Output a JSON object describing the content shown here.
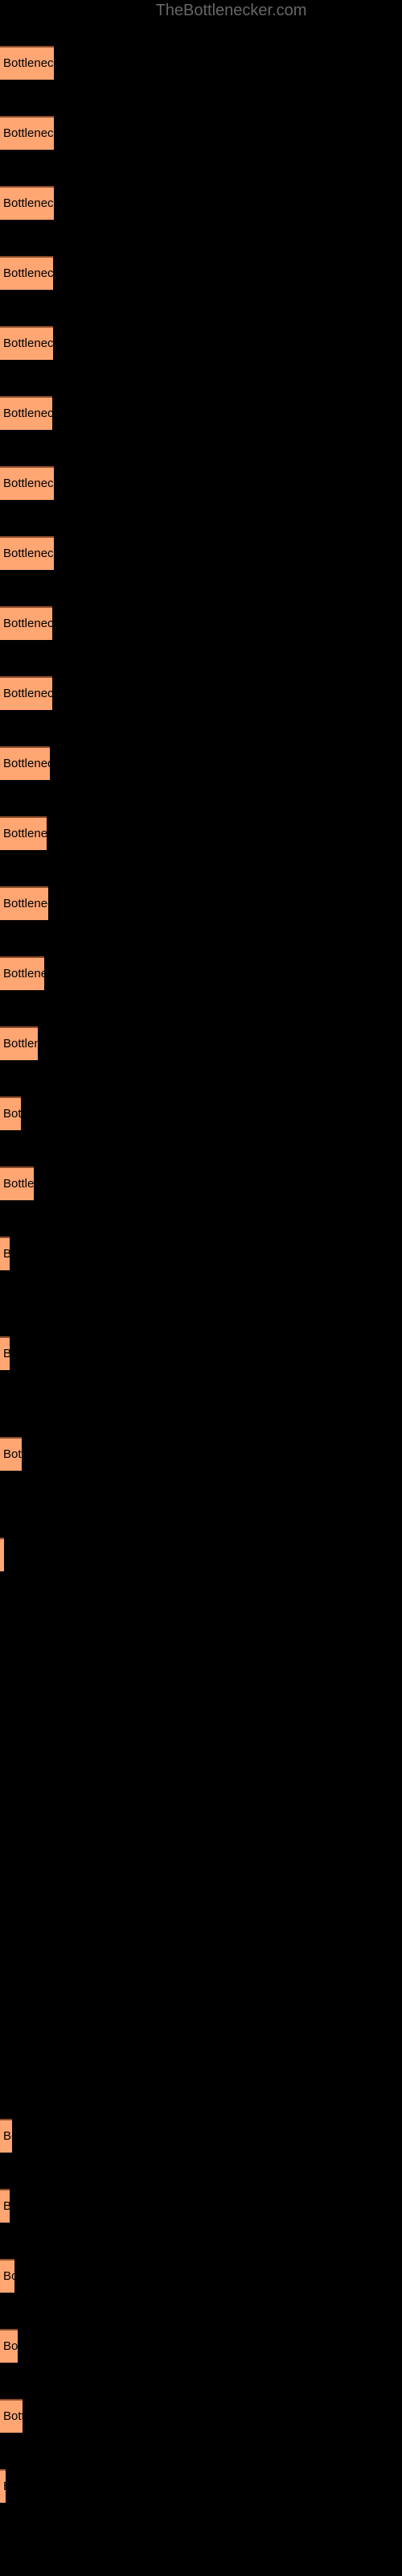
{
  "watermark": {
    "text": "TheBottlenecker.com"
  },
  "colors": {
    "background": "#000000",
    "bar_fill": "#ffa673",
    "bar_border_top": "#8a4a28",
    "label_text": "#000000",
    "watermark_text": "#666666"
  },
  "chart_data": {
    "type": "bar",
    "orientation": "horizontal",
    "title": "",
    "subtitle": "",
    "xlabel": "",
    "ylabel": "",
    "grid": false,
    "legend": false,
    "axis_visible": false,
    "xlim": [
      0,
      500
    ],
    "bar_label_prefix": "Bottleneck result",
    "note": "Each bar is labelled with the text 'Bottleneck result' which is clipped to the bar width, so shorter bars show fewer characters.",
    "categories": [
      "bar-1",
      "bar-2",
      "bar-3",
      "bar-4",
      "bar-5",
      "bar-6",
      "bar-7",
      "bar-8",
      "bar-9",
      "bar-10",
      "bar-11",
      "bar-12",
      "bar-13",
      "bar-14",
      "bar-15",
      "bar-16",
      "bar-17",
      "bar-18",
      "bar-19",
      "bar-20",
      "bar-21",
      "bar-22",
      "bar-23",
      "bar-24",
      "bar-25",
      "bar-26",
      "bar-27",
      "bar-28",
      "bar-29",
      "bar-30",
      "bar-31",
      "bar-32",
      "bar-33",
      "bar-34",
      "bar-35"
    ],
    "values": [
      67,
      67,
      67,
      66,
      66,
      65,
      67,
      67,
      65,
      65,
      62,
      58,
      60,
      55,
      47,
      26,
      42,
      12,
      12,
      27,
      5,
      0,
      0,
      0,
      0,
      0,
      0,
      0,
      15,
      12,
      18,
      22,
      28,
      7,
      0
    ],
    "bars": [
      {
        "label": "Bottleneck result",
        "width": 67,
        "y": 57
      },
      {
        "label": "Bottleneck result",
        "width": 67,
        "y": 144
      },
      {
        "label": "Bottleneck result",
        "width": 67,
        "y": 231
      },
      {
        "label": "Bottleneck result",
        "width": 66,
        "y": 318
      },
      {
        "label": "Bottleneck result",
        "width": 66,
        "y": 405
      },
      {
        "label": "Bottleneck result",
        "width": 65,
        "y": 492
      },
      {
        "label": "Bottleneck result",
        "width": 67,
        "y": 579
      },
      {
        "label": "Bottleneck result",
        "width": 67,
        "y": 666
      },
      {
        "label": "Bottleneck result",
        "width": 65,
        "y": 753
      },
      {
        "label": "Bottleneck result",
        "width": 65,
        "y": 840
      },
      {
        "label": "Bottleneck result",
        "width": 62,
        "y": 927
      },
      {
        "label": "Bottleneck result",
        "width": 58,
        "y": 1014
      },
      {
        "label": "Bottleneck result",
        "width": 60,
        "y": 1101
      },
      {
        "label": "Bottleneck result",
        "width": 55,
        "y": 1188
      },
      {
        "label": "Bottleneck result",
        "width": 47,
        "y": 1275
      },
      {
        "label": "Bottleneck result",
        "width": 26,
        "y": 1362
      },
      {
        "label": "Bottleneck result",
        "width": 42,
        "y": 1449
      },
      {
        "label": "Bottleneck result",
        "width": 12,
        "y": 1536
      },
      {
        "label": "Bottleneck result",
        "width": 12,
        "y": 1660
      },
      {
        "label": "Bottleneck result",
        "width": 27,
        "y": 1785
      },
      {
        "label": "Bottleneck result",
        "width": 5,
        "y": 1910
      },
      {
        "label": "Bottleneck result",
        "width": 0,
        "y": 2035
      },
      {
        "label": "Bottleneck result",
        "width": 0,
        "y": 2122
      },
      {
        "label": "Bottleneck result",
        "width": 0,
        "y": 2209
      },
      {
        "label": "Bottleneck result",
        "width": 0,
        "y": 2296
      },
      {
        "label": "Bottleneck result",
        "width": 0,
        "y": 2383
      },
      {
        "label": "Bottleneck result",
        "width": 0,
        "y": 2470
      },
      {
        "label": "Bottleneck result",
        "width": 0,
        "y": 2557
      },
      {
        "label": "Bottleneck result",
        "width": 15,
        "y": 2632
      },
      {
        "label": "Bottleneck result",
        "width": 12,
        "y": 2719
      },
      {
        "label": "Bottleneck result",
        "width": 18,
        "y": 2806
      },
      {
        "label": "Bottleneck result",
        "width": 22,
        "y": 2893
      },
      {
        "label": "Bottleneck result",
        "width": 28,
        "y": 2980
      },
      {
        "label": "Bottleneck result",
        "width": 7,
        "y": 3067
      },
      {
        "label": "Bottleneck result",
        "width": 0,
        "y": 3154
      }
    ]
  }
}
